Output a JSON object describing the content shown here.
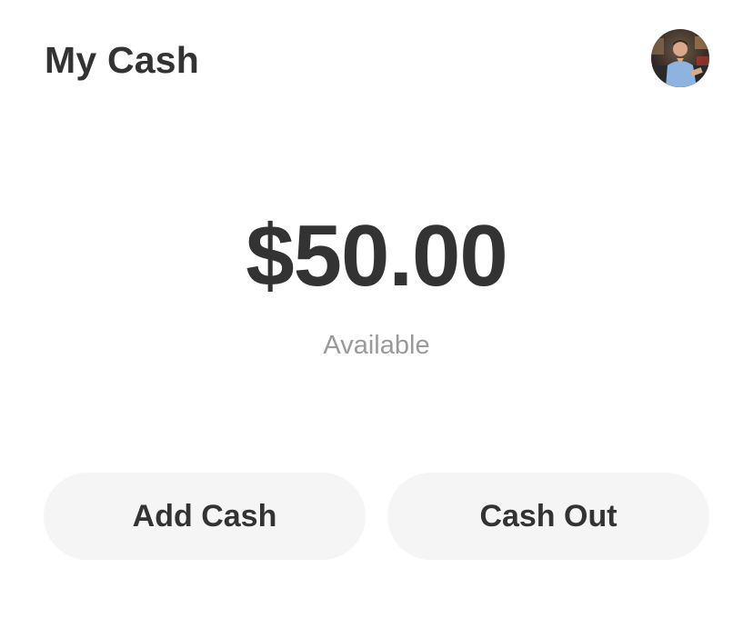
{
  "header": {
    "title": "My Cash",
    "avatar_icon": "profile-photo-avatar"
  },
  "balance": {
    "amount": "$50.00",
    "label": "Available"
  },
  "actions": {
    "add_cash_label": "Add Cash",
    "cash_out_label": "Cash Out"
  },
  "colors": {
    "text_primary": "#333333",
    "text_secondary": "#9a9a9a",
    "button_bg": "#f5f5f5",
    "background": "#ffffff"
  }
}
